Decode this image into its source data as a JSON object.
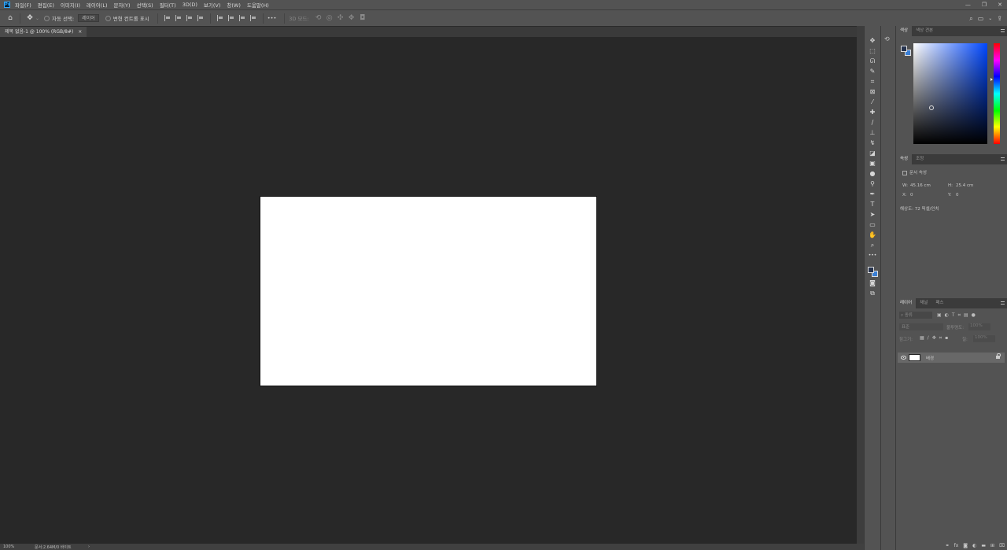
{
  "menu": {
    "logo": "Ps",
    "items": [
      "파일(F)",
      "편집(E)",
      "이미지(I)",
      "레이어(L)",
      "문자(Y)",
      "선택(S)",
      "필터(T)",
      "3D(D)",
      "보기(V)",
      "창(W)",
      "도움말(H)"
    ],
    "window_controls": {
      "minimize": "—",
      "maximize": "❐",
      "close": "✕"
    }
  },
  "options": {
    "auto_select_label": "자동 선택:",
    "auto_select_target": "레이어",
    "show_transform_label": "변형 컨트롤 표시",
    "more": "•••",
    "mode_3d": "3D 모드:"
  },
  "document": {
    "tab_title": "제목 없음-1 @ 100% (RGB/8#)",
    "tab_close": "×",
    "canvas_color": "#ffffff"
  },
  "status": {
    "zoom": "100%",
    "doc_info": "문서:2.64M/0 바이트",
    "arrow": "›"
  },
  "tools": [
    {
      "name": "move-tool",
      "glyph": "✥"
    },
    {
      "name": "marquee-tool",
      "glyph": "⬚"
    },
    {
      "name": "lasso-tool",
      "glyph": "ᘏ"
    },
    {
      "name": "quick-select-tool",
      "glyph": "✎"
    },
    {
      "name": "crop-tool",
      "glyph": "⌗"
    },
    {
      "name": "frame-tool",
      "glyph": "⊠"
    },
    {
      "name": "eyedropper-tool",
      "glyph": "⁄"
    },
    {
      "name": "healing-tool",
      "glyph": "✚"
    },
    {
      "name": "brush-tool",
      "glyph": "∕"
    },
    {
      "name": "stamp-tool",
      "glyph": "⊥"
    },
    {
      "name": "history-brush-tool",
      "glyph": "↯"
    },
    {
      "name": "eraser-tool",
      "glyph": "◪"
    },
    {
      "name": "gradient-tool",
      "glyph": "▣"
    },
    {
      "name": "blur-tool",
      "glyph": "●"
    },
    {
      "name": "dodge-tool",
      "glyph": "⚲"
    },
    {
      "name": "pen-tool",
      "glyph": "✒"
    },
    {
      "name": "type-tool",
      "glyph": "T"
    },
    {
      "name": "path-select-tool",
      "glyph": "➤"
    },
    {
      "name": "rectangle-tool",
      "glyph": "▭"
    },
    {
      "name": "hand-tool",
      "glyph": "✋"
    },
    {
      "name": "zoom-tool",
      "glyph": "⌕"
    },
    {
      "name": "more-tools",
      "glyph": "•••"
    }
  ],
  "colors": {
    "foreground": "#26334e",
    "background": "#3a7fd6"
  },
  "color_panel": {
    "tab_color": "색상",
    "tab_swatches": "색상 견본"
  },
  "properties_panel": {
    "tab_properties": "속성",
    "tab_adjustments": "조정",
    "doc_props_label": "문서 속성",
    "w_label": "W:",
    "w_value": "45.16 cm",
    "h_label": "H:",
    "h_value": "25.4 cm",
    "x_label": "X:",
    "x_value": "0",
    "y_label": "Y:",
    "y_value": "0",
    "resolution": "해상도: 72 픽셀/인치"
  },
  "layers_panel": {
    "tab_layers": "레이어",
    "tab_channels": "채널",
    "tab_paths": "패스",
    "filter_placeholder": "종류",
    "blend_mode": "표준",
    "opacity_label": "불투명도:",
    "opacity_value": "100%",
    "lock_label": "잠그기:",
    "fill_label": "칠:",
    "fill_value": "100%",
    "layer_name": "배경"
  }
}
